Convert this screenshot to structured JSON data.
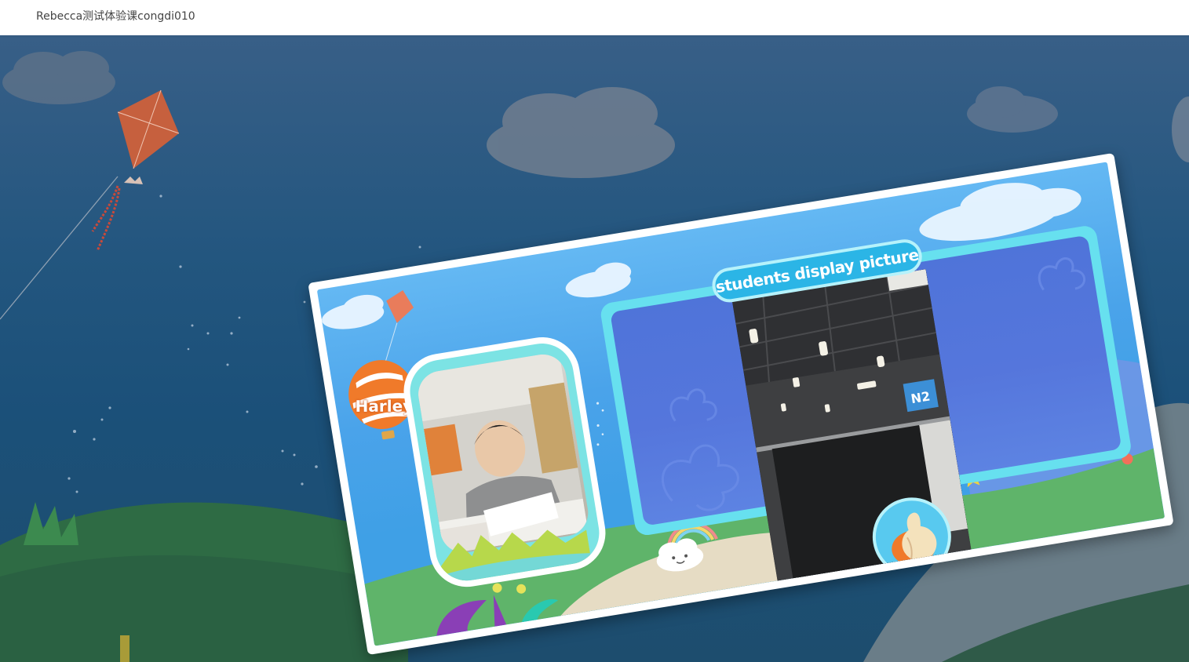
{
  "window": {
    "title": "Rebecca测试体验课congdi010"
  },
  "slide": {
    "banner_title": "students display picture",
    "student_name": "Harley",
    "shared_photo_sign": "N2"
  },
  "icons": {
    "thumbs_up": "thumbs-up-icon",
    "kite": "kite-icon",
    "balloon": "hot-air-balloon-icon",
    "cloud_face": "cloud-face-icon",
    "rainbow": "rainbow-icon"
  },
  "colors": {
    "sky_dark": "#23567f",
    "card_sky": "#4aa3ea",
    "panel_border": "#67e0ef",
    "panel_fill": "#5576dc",
    "banner": "#2bb5e6",
    "grass": "#5fb46a",
    "balloon": "#f07a2a"
  }
}
